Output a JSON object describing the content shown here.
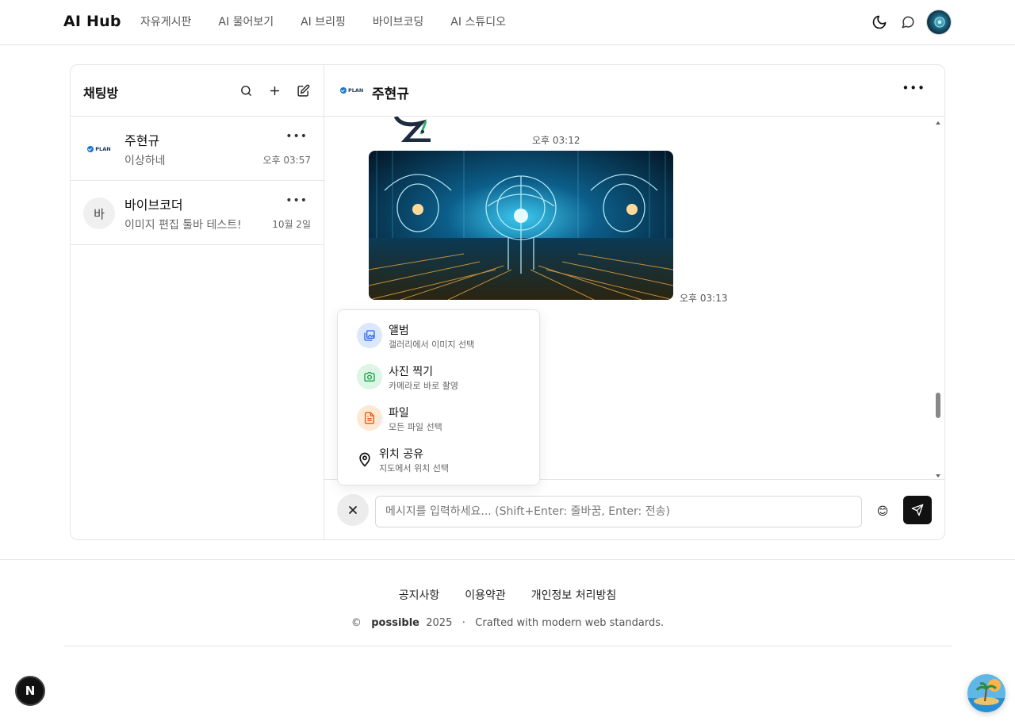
{
  "header": {
    "brand": "AI Hub",
    "nav": [
      "자유게시판",
      "AI 물어보기",
      "AI 브리핑",
      "바이브코딩",
      "AI 스튜디오"
    ]
  },
  "sidebar": {
    "title": "채팅방",
    "rooms": [
      {
        "name": "주현규",
        "last": "이상하네",
        "time": "오후 03:57",
        "avatar": "PLAN"
      },
      {
        "name": "바이브코더",
        "last": "이미지 편집 툴바 테스트!",
        "time": "10월 2일",
        "avatar": "바"
      }
    ]
  },
  "chat": {
    "name": "주현규",
    "logo": "PLAN",
    "times": [
      "오후 03:12",
      "오후 03:13"
    ]
  },
  "attach_menu": {
    "items": [
      {
        "title": "앨범",
        "subtitle": "갤러리에서 이미지 선택"
      },
      {
        "title": "사진 찍기",
        "subtitle": "카메라로 바로 촬영"
      },
      {
        "title": "파일",
        "subtitle": "모든 파일 선택"
      },
      {
        "title": "위치 공유",
        "subtitle": "지도에서 위치 선택"
      }
    ]
  },
  "composer": {
    "placeholder": "메시지를 입력하세요... (Shift+Enter: 줄바꿈, Enter: 전송)",
    "emoji": "😊"
  },
  "footer": {
    "links": [
      "공지사항",
      "이용약관",
      "개인정보 처리방침"
    ],
    "copy_symbol": "©",
    "brand": "possible",
    "year": "2025",
    "sep": "·",
    "tagline": "Crafted with modern web standards."
  },
  "badge": "N"
}
